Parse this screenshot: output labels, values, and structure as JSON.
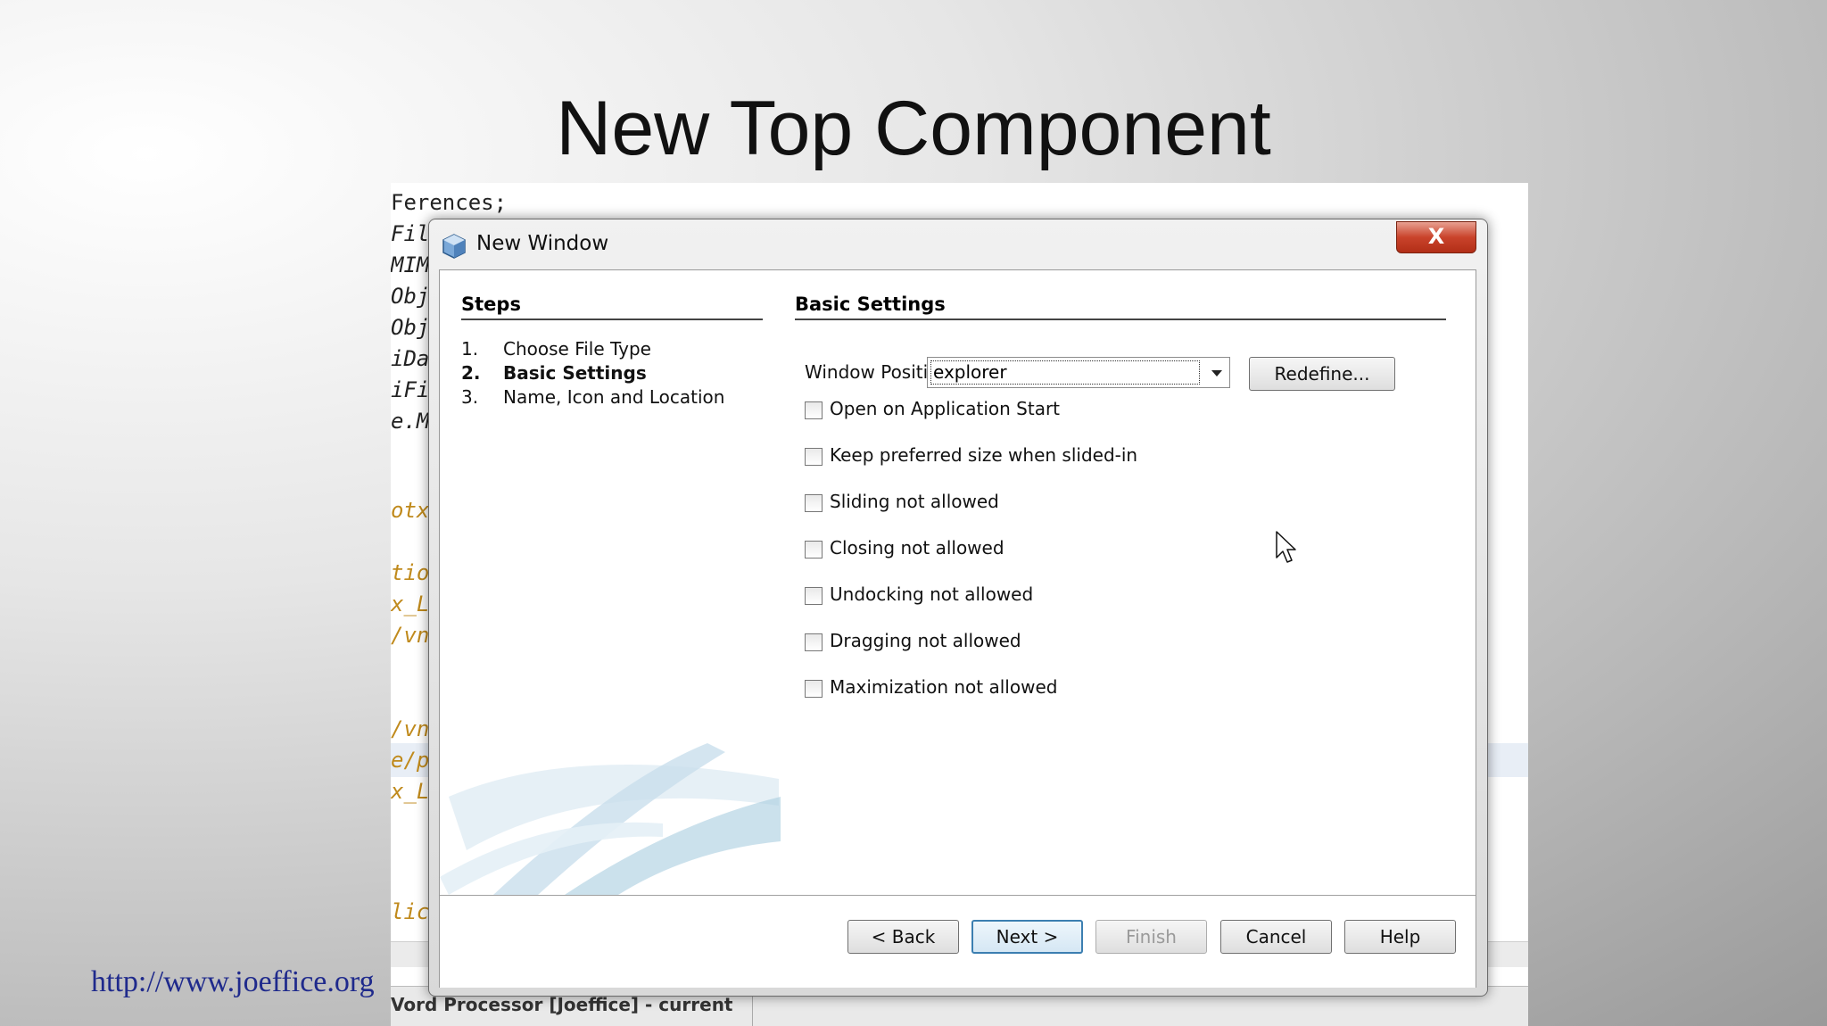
{
  "slide": {
    "title": "New Top Component",
    "footer_url": "http://www.joeffice.org"
  },
  "background_code": {
    "lines": [
      {
        "text": "Ferences;",
        "style": "dark"
      },
      {
        "text": "Fil",
        "style": "dark"
      },
      {
        "text": "MIM",
        "style": "dark"
      },
      {
        "text": "Obj",
        "style": "dark"
      },
      {
        "text": "Obj",
        "style": "dark"
      },
      {
        "text": "iDa",
        "style": "dark"
      },
      {
        "text": "iFi",
        "style": "dark"
      },
      {
        "text": "e.M",
        "style": "dark"
      },
      {
        "text": "otx",
        "style": "orange"
      },
      {
        "text": "tio",
        "style": "orange"
      },
      {
        "text": "x_L",
        "style": "orange"
      },
      {
        "text": "/vn",
        "style": "orange"
      },
      {
        "text": "/vn",
        "style": "orange"
      },
      {
        "text": "e/p",
        "style": "orange"
      },
      {
        "text": "x_L",
        "style": "orange"
      },
      {
        "text": "lic",
        "style": "orange"
      }
    ],
    "status_text": "Vord Processor [Joeffice] - current"
  },
  "dialog": {
    "title": "New Window",
    "close_label": "X",
    "steps": {
      "heading": "Steps",
      "items": [
        {
          "num": "1.",
          "label": "Choose File Type"
        },
        {
          "num": "2.",
          "label": "Basic Settings"
        },
        {
          "num": "3.",
          "label": "Name, Icon and Location"
        }
      ]
    },
    "basic": {
      "heading": "Basic Settings",
      "window_position_label": "Window Position :",
      "window_position_value": "explorer",
      "redefine_label": "Redefine...",
      "options": [
        {
          "label": "Open on Application Start",
          "checked": false
        },
        {
          "label": "Keep preferred size when slided-in",
          "checked": false
        },
        {
          "label": "Sliding not allowed",
          "checked": false
        },
        {
          "label": "Closing not allowed",
          "checked": false
        },
        {
          "label": "Undocking not allowed",
          "checked": false
        },
        {
          "label": "Dragging not allowed",
          "checked": false
        },
        {
          "label": "Maximization not allowed",
          "checked": false
        }
      ]
    },
    "buttons": {
      "back": "< Back",
      "next": "Next >",
      "finish": "Finish",
      "cancel": "Cancel",
      "help": "Help"
    }
  }
}
